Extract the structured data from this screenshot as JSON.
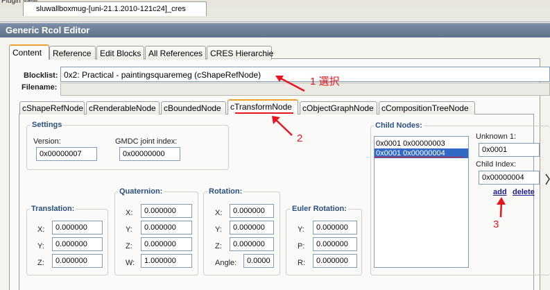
{
  "window": {
    "plugin_view_label": "Plugin View",
    "file_tab": "sluwallboxmug-[uni-21.1.2010-121c24]_cres",
    "title": "Generic Rcol Editor"
  },
  "top_tabs": [
    {
      "label": "Content"
    },
    {
      "label": "Reference"
    },
    {
      "label": "Edit Blocks"
    },
    {
      "label": "All References"
    },
    {
      "label": "CRES Hierarchie"
    }
  ],
  "blocklist": {
    "label": "Blocklist:",
    "value": "0x2: Practical - paintingsquaremeg (cShapeRefNode)"
  },
  "filename": {
    "label": "Filename:",
    "value": ""
  },
  "node_tabs": [
    {
      "label": "cShapeRefNode"
    },
    {
      "label": "cRenderableNode"
    },
    {
      "label": "cBoundedNode"
    },
    {
      "label": "cTransformNode"
    },
    {
      "label": "cObjectGraphNode"
    },
    {
      "label": "cCompositionTreeNode"
    }
  ],
  "settings": {
    "title": "Settings",
    "version_label": "Version:",
    "version_value": "0x00000007",
    "gmdc_label": "GMDC joint index:",
    "gmdc_value": "0x00000000"
  },
  "translation": {
    "title": "Translation:",
    "x_label": "X:",
    "x_value": "0.000000",
    "y_label": "Y:",
    "y_value": "0.000000",
    "z_label": "Z:",
    "z_value": "0.000000"
  },
  "quaternion": {
    "title": "Quaternion:",
    "x_label": "X:",
    "x_value": "0.000000",
    "y_label": "Y:",
    "y_value": "0.000000",
    "z_label": "Z:",
    "z_value": "0.000000",
    "w_label": "W:",
    "w_value": "1.000000"
  },
  "rotation": {
    "title": "Rotation:",
    "x_label": "X:",
    "x_value": "0.000000",
    "y_label": "Y:",
    "y_value": "0.000000",
    "z_label": "Z:",
    "z_value": "0.000000",
    "angle_label": "Angle:",
    "angle_value": "0.0000"
  },
  "euler": {
    "title": "Euler Rotation:",
    "y_label": "Y:",
    "y_value": "0.000000",
    "p_label": "P:",
    "p_value": "0.000000",
    "r_label": "R:",
    "r_value": "0.000000"
  },
  "child_nodes": {
    "title": "Child Nodes:",
    "items": [
      {
        "text": "0x0001 0x00000003"
      },
      {
        "text": "0x0001 0x00000004"
      }
    ],
    "unknown_label": "Unknown 1:",
    "unknown_value": "0x0001",
    "child_index_label": "Child Index:",
    "child_index_value": "0x00000004",
    "add_label": "add",
    "delete_label": "delete"
  },
  "annotations": {
    "step1": "1 選択",
    "step2": "2",
    "step3": "3",
    "color": "#e8141e"
  }
}
